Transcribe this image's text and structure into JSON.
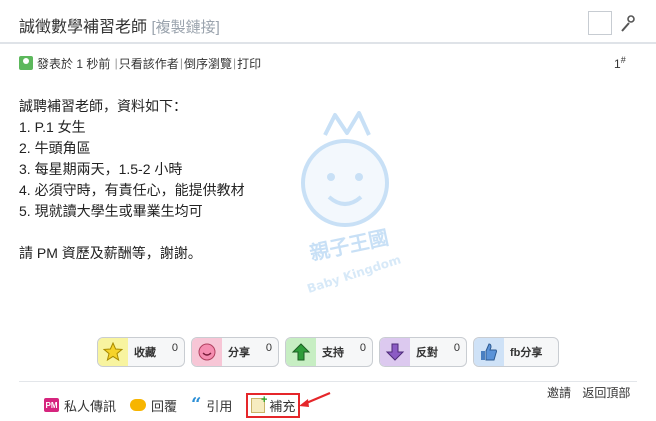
{
  "header": {
    "title": "誠徵數學補習老師",
    "copy_link": "[複製鏈接]"
  },
  "meta": {
    "posted": "發表於 1 秒前",
    "only_author": "只看該作者",
    "reverse": "倒序瀏覽",
    "print": "打印",
    "floor": "1",
    "floor_mark": "#"
  },
  "post": {
    "lines": [
      "誠聘補習老師，資料如下：",
      "1. P.1 女生",
      "2. 牛頭角區",
      "3. 每星期兩天，1.5-2 小時",
      "4. 必須守時，有責任心，能提供教材",
      "5. 現就讀大學生或畢業生均可",
      "",
      "請 PM 資歷及薪酬等，謝謝。"
    ]
  },
  "watermark": {
    "brand": "親子王國",
    "sub": "Baby Kingdom"
  },
  "reactions": [
    {
      "label": "收藏",
      "count": "0",
      "color": "#f8f4a0",
      "icon": "star-icon"
    },
    {
      "label": "分享",
      "count": "0",
      "color": "#f7c6d6",
      "icon": "heart-icon"
    },
    {
      "label": "支持",
      "count": "0",
      "color": "#c7eec3",
      "icon": "up-arrow-icon"
    },
    {
      "label": "反對",
      "count": "0",
      "color": "#dcc9ef",
      "icon": "down-arrow-icon"
    },
    {
      "label": "fb分享",
      "count": "",
      "color": "#cfe2f7",
      "icon": "thumbs-up-icon"
    }
  ],
  "actions": {
    "pm": "私人傳訊",
    "pm_icon_text": "PM",
    "reply": "回覆",
    "quote": "引用",
    "supplement": "補充"
  },
  "right_links": {
    "invite": "邀請",
    "back_top": "返回頂部"
  }
}
